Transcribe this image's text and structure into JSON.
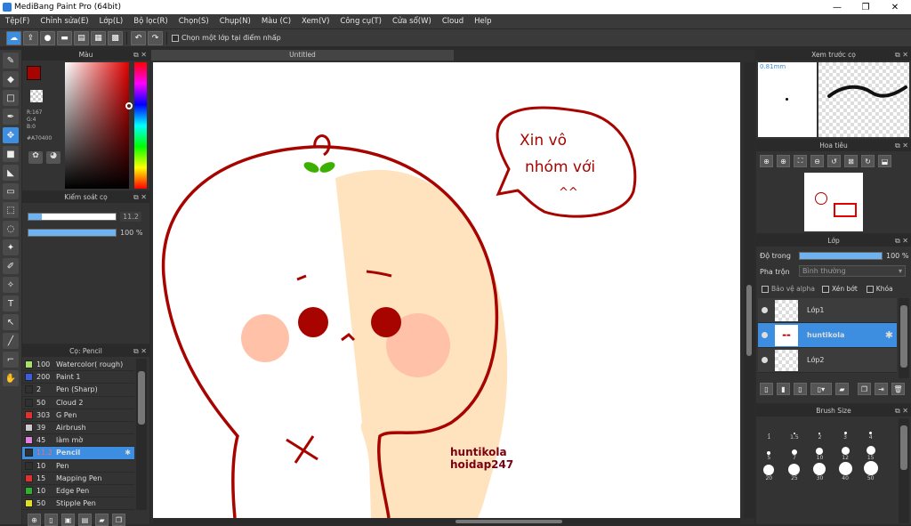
{
  "window": {
    "title": "MediBang Paint Pro (64bit)",
    "minimize": "—",
    "maximize": "❐",
    "close": "✕"
  },
  "menu": [
    "Tệp(F)",
    "Chỉnh sửa(E)",
    "Lớp(L)",
    "Bộ lọc(R)",
    "Chọn(S)",
    "Chụp(N)",
    "Màu (C)",
    "Xem(V)",
    "Công cụ(T)",
    "Cửa sổ(W)",
    "Cloud",
    "Help"
  ],
  "toolbar": {
    "snap_label": "Chọn một lớp tại điểm nhấp",
    "undo": "↶",
    "redo": "↷"
  },
  "color_panel": {
    "title": "Màu",
    "r": "R:167",
    "g": "G:4",
    "b": "B:0",
    "hex": "#A70400",
    "primary": "#A70400",
    "secondary": "#ffffff"
  },
  "brush_control": {
    "title": "Kiểm soát cọ",
    "size": "11.2",
    "opacity": "100 %",
    "size_fraction": 0.15,
    "opacity_fraction": 1.0
  },
  "brush_list": {
    "title": "Cọ: Pencil",
    "items": [
      {
        "size": "100",
        "name": "Watercolor( rough)",
        "color": "#a8e06a"
      },
      {
        "size": "200",
        "name": "Paint 1",
        "color": "#3b5ee0"
      },
      {
        "size": "2",
        "name": "Pen (Sharp)",
        "color": "#303030"
      },
      {
        "size": "50",
        "name": "Cloud 2",
        "color": "#303030"
      },
      {
        "size": "303",
        "name": "G Pen",
        "color": "#e03030"
      },
      {
        "size": "39",
        "name": "Airbrush",
        "color": "#cccccc"
      },
      {
        "size": "45",
        "name": "làm mờ",
        "color": "#e080e0"
      },
      {
        "size": "11.2",
        "name": "Pencil",
        "color": "#303030"
      },
      {
        "size": "10",
        "name": "Pen",
        "color": "#303030"
      },
      {
        "size": "15",
        "name": "Mapping Pen",
        "color": "#e03030"
      },
      {
        "size": "10",
        "name": "Edge Pen",
        "color": "#30b030"
      },
      {
        "size": "50",
        "name": "Stipple Pen",
        "color": "#e0e020"
      }
    ]
  },
  "document": {
    "tab": "Untitled"
  },
  "artwork": {
    "speech1": "Xin vô",
    "speech2": "nhóm với",
    "speech3": "^^",
    "sig1": "huntikola",
    "sig2": "hoidap247"
  },
  "preview_panel": {
    "title": "Xem trước cọ",
    "size_label": "0.81mm"
  },
  "navigator": {
    "title": "Hoa tiêu"
  },
  "layers": {
    "title": "Lớp",
    "opacity_label": "Độ trong",
    "opacity_value": "100 %",
    "opacity_fraction": 1.0,
    "blend_label": "Pha trộn",
    "blend_value": "Bình thường",
    "protect_alpha": "Bảo vệ alpha",
    "clip": "Xén bớt",
    "lock": "Khóa",
    "items": [
      {
        "name": "Lớp1"
      },
      {
        "name": "huntikola"
      },
      {
        "name": "Lớp2"
      }
    ]
  },
  "brush_size": {
    "title": "Brush Size",
    "labels": [
      "1",
      "1.5",
      "2",
      "3",
      "4",
      "5",
      "7",
      "10",
      "12",
      "15",
      "20",
      "25",
      "30",
      "40",
      "50"
    ]
  }
}
